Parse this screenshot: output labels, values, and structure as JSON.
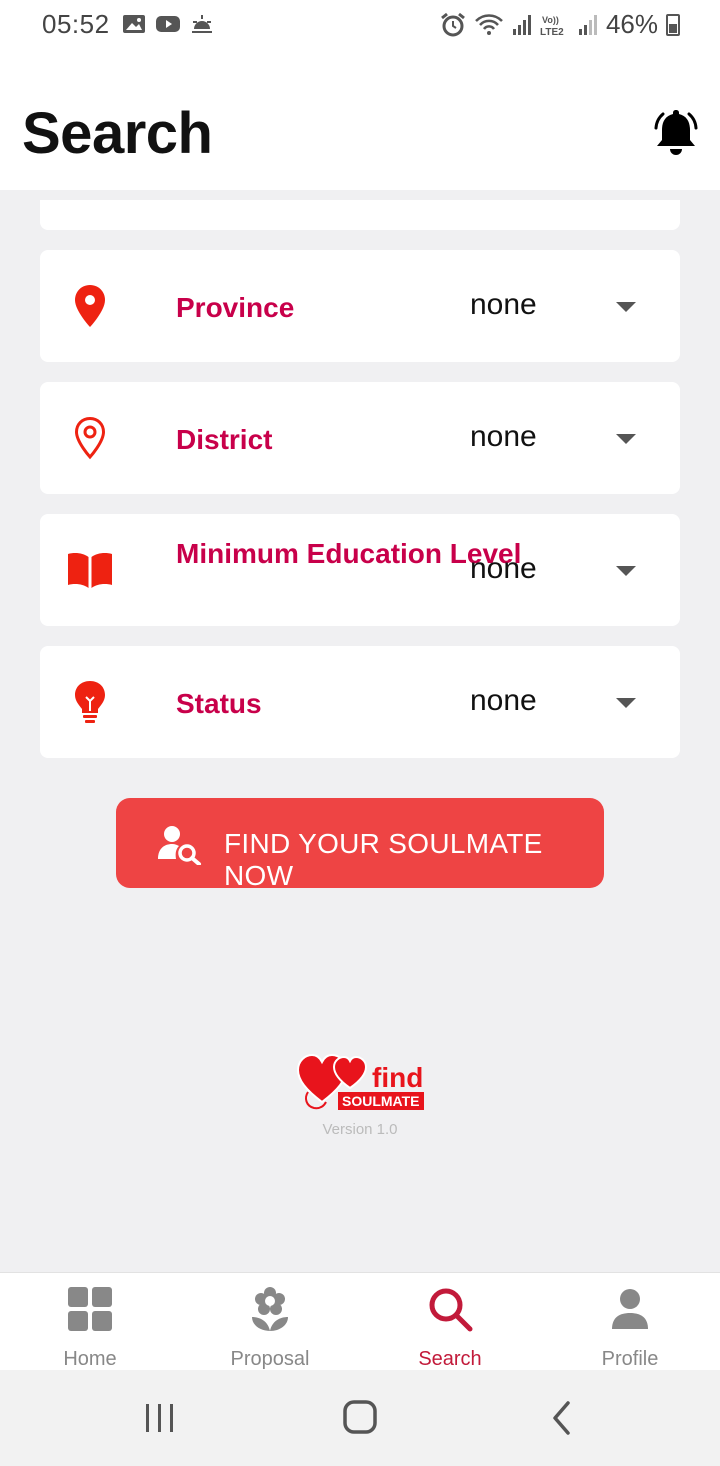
{
  "status_bar": {
    "time": "05:52",
    "battery": "46%",
    "left_icons": [
      "gallery-icon",
      "youtube-icon",
      "weather-icon"
    ],
    "right_icons": [
      "alarm-icon",
      "wifi-icon",
      "signal-icon",
      "volte-icon",
      "signal-icon",
      "battery-icon"
    ],
    "volte": "Vo))\nLTE2"
  },
  "header": {
    "title": "Search",
    "notification_icon": "bell-icon"
  },
  "filters": [
    {
      "label": "Province",
      "value": "none",
      "icon": "map-marker-icon"
    },
    {
      "label": "District",
      "value": "none",
      "icon": "map-pin-outline-icon"
    },
    {
      "label": "Minimum Education Level",
      "value": "none",
      "icon": "book-icon"
    },
    {
      "label": "Status",
      "value": "none",
      "icon": "lightbulb-icon"
    }
  ],
  "cta": {
    "label": "FIND YOUR SOULMATE NOW",
    "icon": "user-search-icon"
  },
  "logo": {
    "line1": "find",
    "line2": "SOULMATE",
    "version": "Version 1.0"
  },
  "bottom_nav": [
    {
      "label": "Home",
      "icon": "grid-icon"
    },
    {
      "label": "Proposal",
      "icon": "flower-icon"
    },
    {
      "label": "Search",
      "icon": "search-icon",
      "active": true
    },
    {
      "label": "Profile",
      "icon": "person-icon"
    }
  ],
  "colors": {
    "accent": "#c8004a",
    "icon_red": "#ee2211",
    "cta": "#ee4444",
    "active_nav": "#c21a3a",
    "background": "#f0f0f2"
  }
}
